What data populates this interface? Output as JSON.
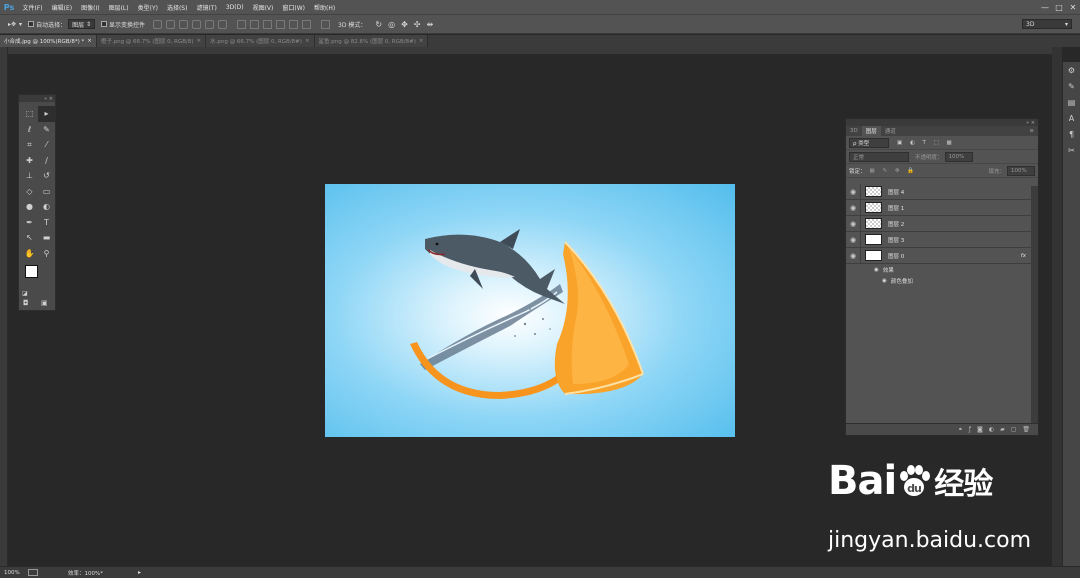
{
  "app": {
    "logo": "Ps"
  },
  "menu": [
    "文件(F)",
    "编辑(E)",
    "图像(I)",
    "图层(L)",
    "类型(Y)",
    "选择(S)",
    "滤镜(T)",
    "3D(D)",
    "视图(V)",
    "窗口(W)",
    "帮助(H)"
  ],
  "window_controls": [
    "—",
    "□",
    "✕"
  ],
  "options": {
    "auto_select_label": "自动选择：",
    "auto_select_value": "图层",
    "show_transform_label": "显示变换控件",
    "mode_3d_label": "3D 模式：",
    "workspace": "3D"
  },
  "tabs": [
    {
      "label": "小合成.jpg @ 100%(RGB/8*) *",
      "active": true
    },
    {
      "label": "橙子.png @ 66.7% (图层 0, RGB/8)",
      "active": false
    },
    {
      "label": "水.png @ 66.7% (图层 0, RGB/8#)",
      "active": false
    },
    {
      "label": "鲨鱼.png @ 82.6% (图层 0, RGB/8#)",
      "active": false
    }
  ],
  "layers_panel": {
    "tabs": [
      "3D",
      "图层",
      "通道"
    ],
    "filter": "ρ 类型",
    "blend_mode": "正常",
    "opacity_label": "不透明度：",
    "opacity_value": "100%",
    "lock_label": "锁定：",
    "fill_label": "填充：",
    "fill_value": "100%",
    "layers": [
      {
        "name": "图层 4",
        "thumb": "checker"
      },
      {
        "name": "图层 1",
        "thumb": "checker"
      },
      {
        "name": "图层 2",
        "thumb": "checker"
      },
      {
        "name": "图层 3",
        "thumb": "white"
      },
      {
        "name": "图层 0",
        "thumb": "white",
        "fx": "fx"
      }
    ],
    "effects_label": "效果",
    "effect_item": "颜色叠加"
  },
  "status": {
    "zoom": "100%",
    "efficiency": "效率：100%*"
  },
  "watermark": {
    "brand_a": "Bai",
    "brand_b": "du",
    "brand_cn": "经验",
    "url": "jingyan.baidu.com"
  },
  "colors": {
    "canvas_edge": "#53bdec",
    "canvas_center": "#ffffff",
    "orange": "#f7941d",
    "shark": "#4c5a66"
  }
}
